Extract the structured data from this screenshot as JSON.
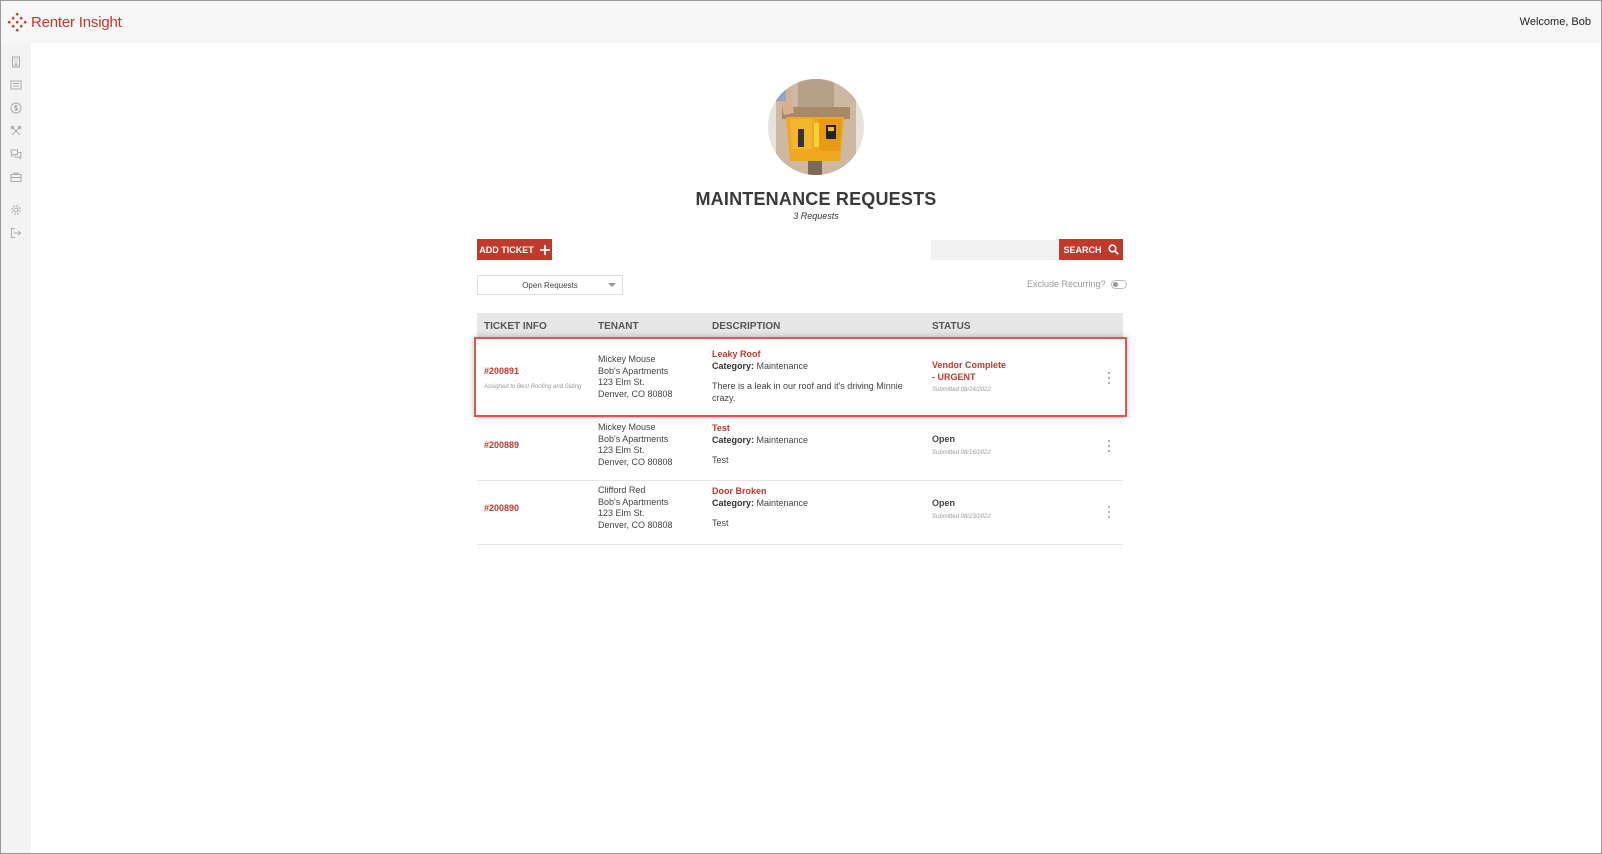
{
  "app": {
    "name": "Renter Insight",
    "welcome": "Welcome, Bob"
  },
  "sidebar": {
    "items": [
      {
        "icon": "building-icon"
      },
      {
        "icon": "list-icon"
      },
      {
        "icon": "dollar-icon"
      },
      {
        "icon": "tools-icon"
      },
      {
        "icon": "chat-icon"
      },
      {
        "icon": "briefcase-icon"
      },
      {
        "icon": "gear-icon"
      },
      {
        "icon": "logout-icon"
      }
    ]
  },
  "page": {
    "title": "MAINTENANCE REQUESTS",
    "subtitle": "3 Requests"
  },
  "toolbar": {
    "add_label": "ADD TICKET",
    "search_label": "SEARCH",
    "search_value": "",
    "filter_selected": "Open Requests",
    "exclude_label": "Exclude Recurring?"
  },
  "table": {
    "headers": [
      "TICKET INFO",
      "TENANT",
      "DESCRIPTION",
      "STATUS"
    ],
    "rows": [
      {
        "ticket": "#200891",
        "assigned": "Assigned to Best Roofing and Siding",
        "tenant": [
          "Mickey Mouse",
          "Bob's Apartments",
          "123 Elm St.",
          "Denver, CO 80808"
        ],
        "title": "Leaky Roof",
        "category_label": "Category:",
        "category": "Maintenance",
        "description": "There is a leak in our roof and it's driving Minnie crazy.",
        "status_line1": "Vendor Complete",
        "status_line2": "- URGENT",
        "submitted": "Submitted 08/24/2022"
      },
      {
        "ticket": "#200889",
        "tenant": [
          "Mickey Mouse",
          "Bob's Apartments",
          "123 Elm St.",
          "Denver, CO 80808"
        ],
        "title": "Test",
        "category_label": "Category:",
        "category": "Maintenance",
        "description": "Test",
        "status": "Open",
        "submitted": "Submitted 08/16/2022"
      },
      {
        "ticket": "#200890",
        "tenant": [
          "Clifford Red",
          "Bob's Apartments",
          "123 Elm St.",
          "Denver, CO 80808"
        ],
        "title": "Door Broken",
        "category_label": "Category:",
        "category": "Maintenance",
        "description": "Test",
        "status": "Open",
        "submitted": "Submitted 08/23/2022"
      }
    ]
  },
  "colors": {
    "accent": "#c0392b",
    "header_bg": "#e6e6e6",
    "highlight": "#e05555"
  }
}
